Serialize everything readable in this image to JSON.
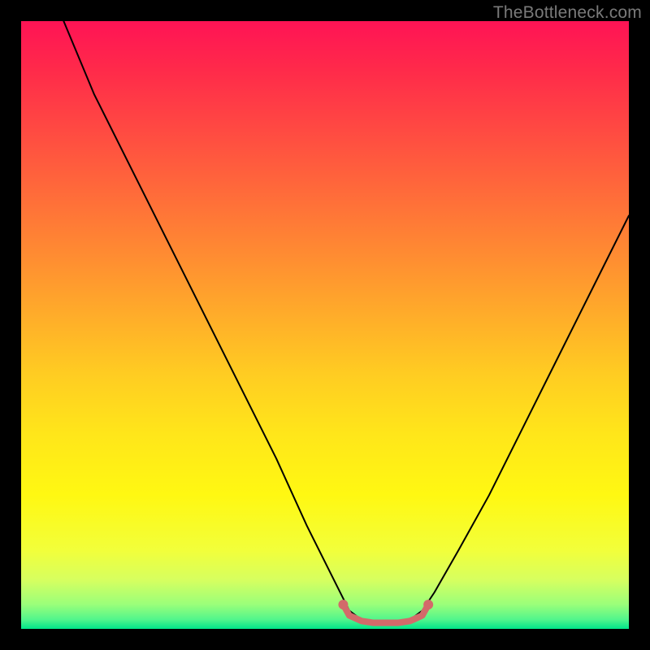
{
  "watermark": "TheBottleneck.com",
  "chart_data": {
    "type": "line",
    "title": "",
    "xlabel": "",
    "ylabel": "",
    "xlim": [
      0,
      100
    ],
    "ylim": [
      0,
      100
    ],
    "series": [
      {
        "name": "curve",
        "x": [
          7,
          12,
          18,
          24,
          30,
          36,
          42,
          47,
          52,
          54,
          56,
          58,
          60,
          62,
          64,
          66,
          68,
          72,
          77,
          82,
          88,
          94,
          100
        ],
        "y": [
          100,
          88,
          76,
          64,
          52,
          40,
          28,
          17,
          7,
          3,
          1.5,
          1,
          1,
          1,
          1.5,
          3,
          6,
          13,
          22,
          32,
          44,
          56,
          68
        ]
      },
      {
        "name": "flat-highlight",
        "x": [
          53,
          54,
          56,
          58,
          60,
          62,
          64,
          66,
          67
        ],
        "y": [
          4,
          2.2,
          1.3,
          1,
          1,
          1,
          1.3,
          2.2,
          4
        ]
      }
    ],
    "colors": {
      "curve": "#000000",
      "flat_highlight": "#d36a6a",
      "gradient_top": "#ff1355",
      "gradient_bottom": "#00e58a",
      "background_frame": "#000000"
    }
  }
}
